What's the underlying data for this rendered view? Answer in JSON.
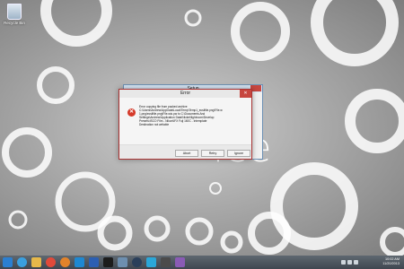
{
  "desktop": {
    "recycle_bin_label": "Recycle Bin",
    "brand_text": "ice"
  },
  "setup_window": {
    "title": "Setup"
  },
  "error_dialog": {
    "title": "Error",
    "message": "Error copying file from packed archive\nC:\\Users\\Andrew\\AppData\\Local\\Temp\\Temp1_ecsilfile.png\\File.w\n1.png\\ecsilfile.png\\File.wio.pw to C:\\Documents And\nSettings\\Andrew\\Application Data\\Nickel\\lightroom\\Develop\nPresets\\ISCO Film - Nikon\\IFX Fuji 160C - Intemplate\nDestination not writable",
    "buttons": {
      "abort": "Abort",
      "retry": "Retry",
      "ignore": "Ignore"
    },
    "icon": "error-x-icon"
  },
  "taskbar": {
    "icons": [
      "start-icon",
      "ie-icon",
      "folder-icon",
      "chrome-icon",
      "firefox-icon",
      "windows-store-icon",
      "word-icon",
      "terminal-icon",
      "settings-icon",
      "steam-icon",
      "media-icon",
      "game-icon",
      "app-icon"
    ],
    "clock_time": "10:02 AM",
    "clock_date": "11/20/2013"
  },
  "colors": {
    "error_red": "#d53a2a",
    "close_button": "#c7463f",
    "taskbar": "#4a525b"
  }
}
